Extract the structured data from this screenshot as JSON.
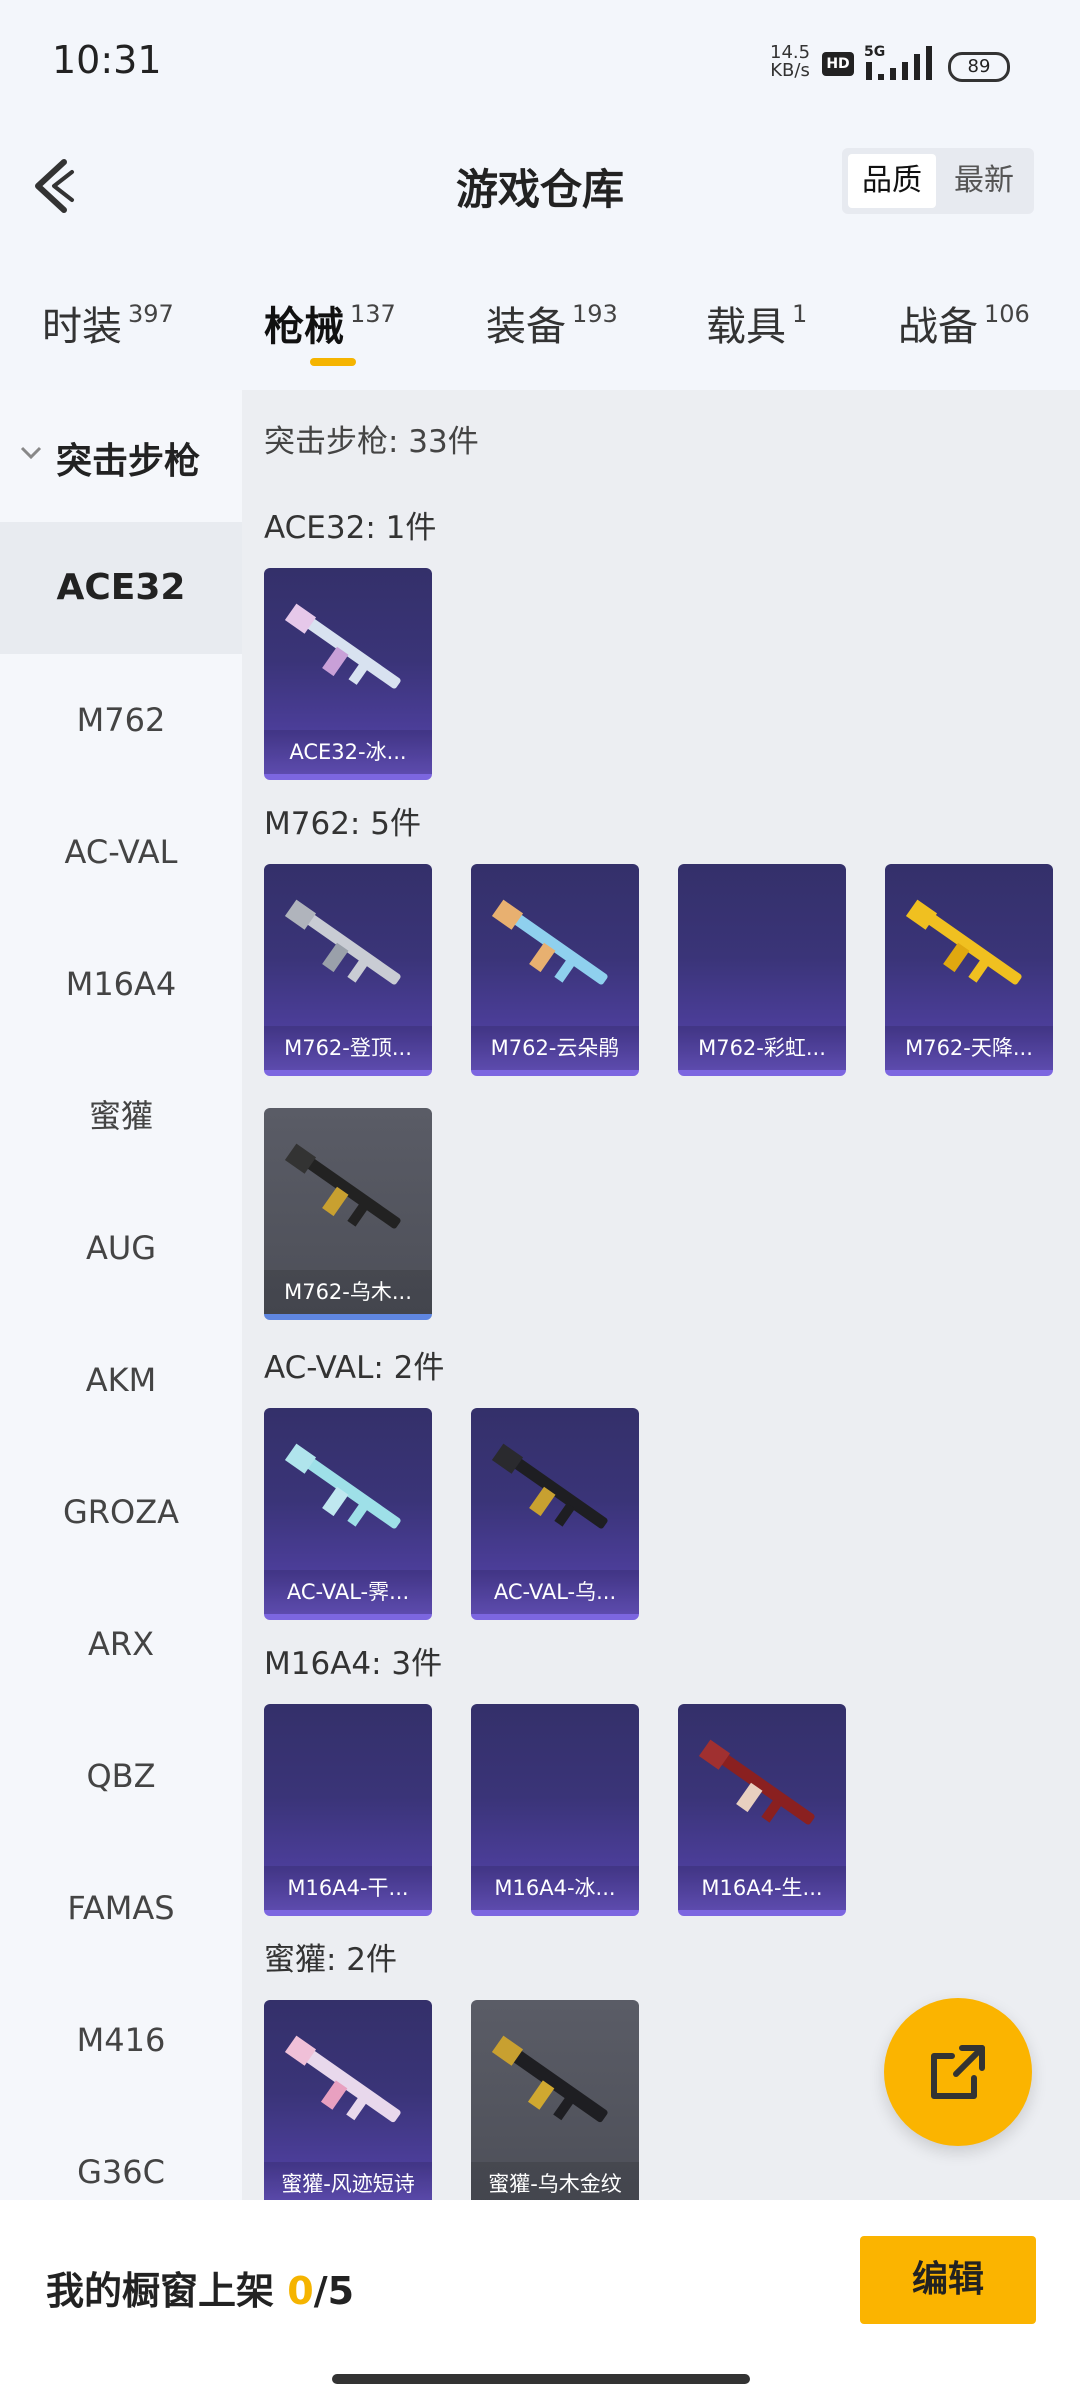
{
  "status_bar": {
    "time": "10:31",
    "net_speed_value": "14.5",
    "net_speed_unit": "KB/s",
    "hd_label": "HD",
    "network_label": "5G",
    "battery": "89"
  },
  "header": {
    "title": "游戏仓库",
    "sort_quality": "品质",
    "sort_latest": "最新"
  },
  "tabs": [
    {
      "label": "时装",
      "count": "397"
    },
    {
      "label": "枪械",
      "count": "137"
    },
    {
      "label": "装备",
      "count": "193"
    },
    {
      "label": "载具",
      "count": "1"
    },
    {
      "label": "战备",
      "count": "106"
    }
  ],
  "sidebar": {
    "category": "突击步枪",
    "items": [
      "ACE32",
      "M762",
      "AC-VAL",
      "M16A4",
      "蜜獾",
      "AUG",
      "AKM",
      "GROZA",
      "ARX",
      "QBZ",
      "FAMAS",
      "M416",
      "G36C"
    ]
  },
  "main": {
    "section_total": "突击步枪: 33件",
    "groups": [
      {
        "title": "ACE32: 1件",
        "items": [
          "ACE32-冰..."
        ]
      },
      {
        "title": "M762: 5件",
        "items": [
          "M762-登顶...",
          "M762-云朵鹃",
          "M762-彩虹...",
          "M762-天降...",
          "M762-乌木..."
        ]
      },
      {
        "title": "AC-VAL: 2件",
        "items": [
          "AC-VAL-霁...",
          "AC-VAL-乌..."
        ]
      },
      {
        "title": "M16A4: 3件",
        "items": [
          "M16A4-干...",
          "M16A4-冰...",
          "M16A4-生..."
        ]
      },
      {
        "title": "蜜獾: 2件",
        "items": [
          "蜜獾-风迹短诗",
          "蜜獾-乌木金纹"
        ]
      }
    ]
  },
  "bottom": {
    "shelf_label": "我的橱窗上架",
    "shelf_current": "0",
    "shelf_total": "/5",
    "edit_label": "编辑"
  },
  "colors": {
    "accent": "#fbb400",
    "card_purple": "#3a3478",
    "card_grey": "#4d4f58"
  }
}
